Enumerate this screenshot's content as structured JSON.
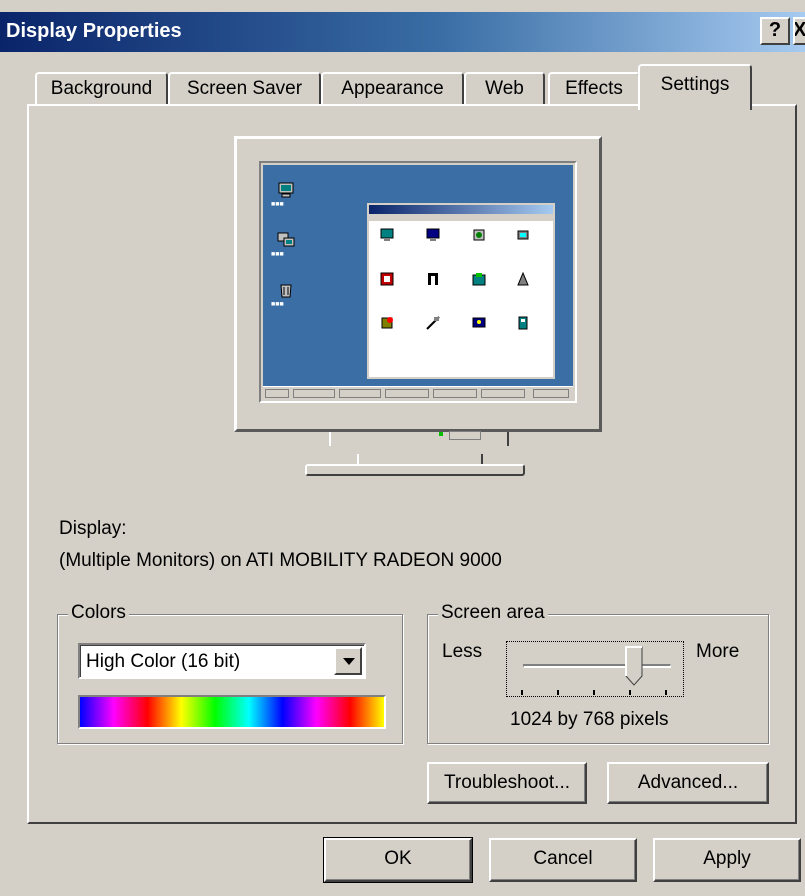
{
  "window": {
    "title": "Display Properties",
    "help_button": "?",
    "close_button": "X"
  },
  "tabs": [
    {
      "label": "Background",
      "active": false
    },
    {
      "label": "Screen Saver",
      "active": false
    },
    {
      "label": "Appearance",
      "active": false
    },
    {
      "label": "Web",
      "active": false
    },
    {
      "label": "Effects",
      "active": false
    },
    {
      "label": "Settings",
      "active": true
    }
  ],
  "display": {
    "label": "Display:",
    "device": "(Multiple Monitors) on ATI MOBILITY RADEON 9000"
  },
  "colors_group": {
    "title": "Colors",
    "selected": "High Color (16 bit)"
  },
  "screen_area": {
    "title": "Screen area",
    "less_label": "Less",
    "more_label": "More",
    "resolution_text": "1024 by 768 pixels",
    "slider_position": 0.75
  },
  "buttons": {
    "troubleshoot": "Troubleshoot...",
    "advanced": "Advanced...",
    "ok": "OK",
    "cancel": "Cancel",
    "apply": "Apply"
  },
  "colors": {
    "title_bar_start": "#0a246a",
    "title_bar_end": "#a6caf0",
    "dialog_face": "#d4d0c8",
    "preview_desktop": "#3a6ea5"
  }
}
